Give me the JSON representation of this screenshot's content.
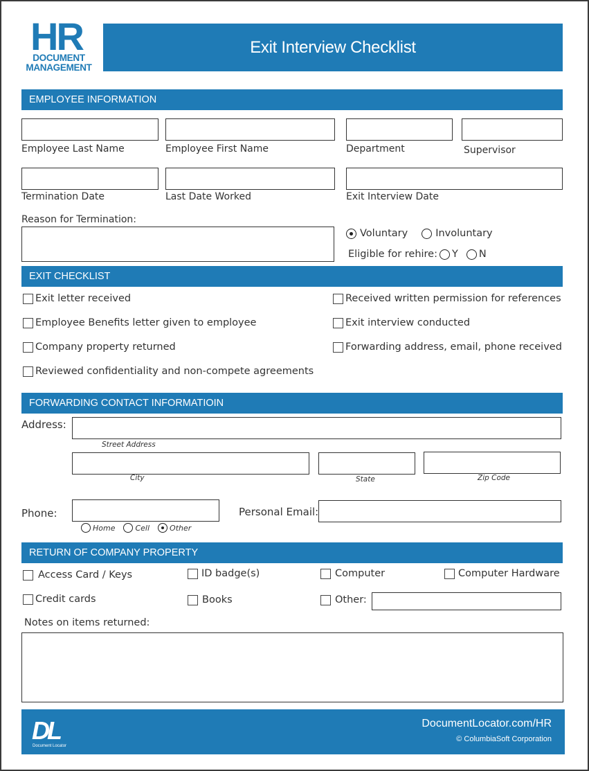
{
  "header": {
    "logo_main": "HR",
    "logo_sub_1": "DOCUMENT",
    "logo_sub_2": "MANAGEMENT",
    "title": "Exit Interview Checklist"
  },
  "colors": {
    "brand_blue": "#1f7bb6",
    "text": "#333333",
    "border": "#333333"
  },
  "employee_info": {
    "section_title": "EMPLOYEE INFORMATION",
    "fields": {
      "last_name": {
        "label": "Employee Last Name",
        "value": ""
      },
      "first_name": {
        "label": "Employee First Name",
        "value": ""
      },
      "department": {
        "label": "Department",
        "value": ""
      },
      "supervisor": {
        "label": "Supervisor",
        "value": ""
      },
      "termination_date": {
        "label": "Termination Date",
        "value": ""
      },
      "last_date_worked": {
        "label": "Last Date Worked",
        "value": ""
      },
      "exit_interview_date": {
        "label": "Exit Interview Date",
        "value": ""
      },
      "reason": {
        "label": "Reason for Termination:",
        "value": ""
      }
    },
    "termination_type": {
      "options": [
        {
          "label": "Voluntary",
          "selected": true
        },
        {
          "label": "Involuntary",
          "selected": false
        }
      ]
    },
    "rehire": {
      "label": "Eligible for rehire:",
      "options": [
        {
          "label": "Y",
          "selected": false
        },
        {
          "label": "N",
          "selected": false
        }
      ]
    }
  },
  "exit_checklist": {
    "section_title": "EXIT CHECKLIST",
    "left_items": [
      {
        "label": "Exit letter received",
        "checked": false
      },
      {
        "label": "Employee Benefits letter given to employee",
        "checked": false
      },
      {
        "label": "Company property returned",
        "checked": false
      },
      {
        "label": "Reviewed confidentiality and non-compete agreements",
        "checked": false
      }
    ],
    "right_items": [
      {
        "label": "Received written permission for references",
        "checked": false
      },
      {
        "label": "Exit interview conducted",
        "checked": false
      },
      {
        "label": "Forwarding address, email, phone received",
        "checked": false
      }
    ]
  },
  "forwarding": {
    "section_title": "FORWARDING CONTACT INFORMATIOIN",
    "address_label": "Address:",
    "street_caption": "Street Address",
    "city_caption": "City",
    "state_caption": "State",
    "zip_caption": "Zip Code",
    "street_value": "",
    "city_value": "",
    "state_value": "",
    "zip_value": "",
    "phone_label": "Phone:",
    "phone_value": "",
    "phone_types": [
      {
        "label": "Home",
        "selected": false
      },
      {
        "label": "Cell",
        "selected": false
      },
      {
        "label": "Other",
        "selected": true
      }
    ],
    "email_label": "Personal Email:",
    "email_value": ""
  },
  "property": {
    "section_title": "RETURN OF COMPANY PROPERTY",
    "items": [
      {
        "label": "Access Card / Keys",
        "checked": false
      },
      {
        "label": "ID badge(s)",
        "checked": false
      },
      {
        "label": "Computer",
        "checked": false
      },
      {
        "label": "Computer Hardware",
        "checked": false
      },
      {
        "label": "Credit cards",
        "checked": false
      },
      {
        "label": "Books",
        "checked": false
      },
      {
        "label": "Other:",
        "checked": false
      }
    ],
    "other_value": "",
    "notes_label": "Notes on items returned:",
    "notes_value": ""
  },
  "footer": {
    "logo_text": "DL",
    "logo_caption": "Document Locator",
    "url": "DocumentLocator.com/HR",
    "copyright": "© ColumbiaSoft Corporation"
  }
}
